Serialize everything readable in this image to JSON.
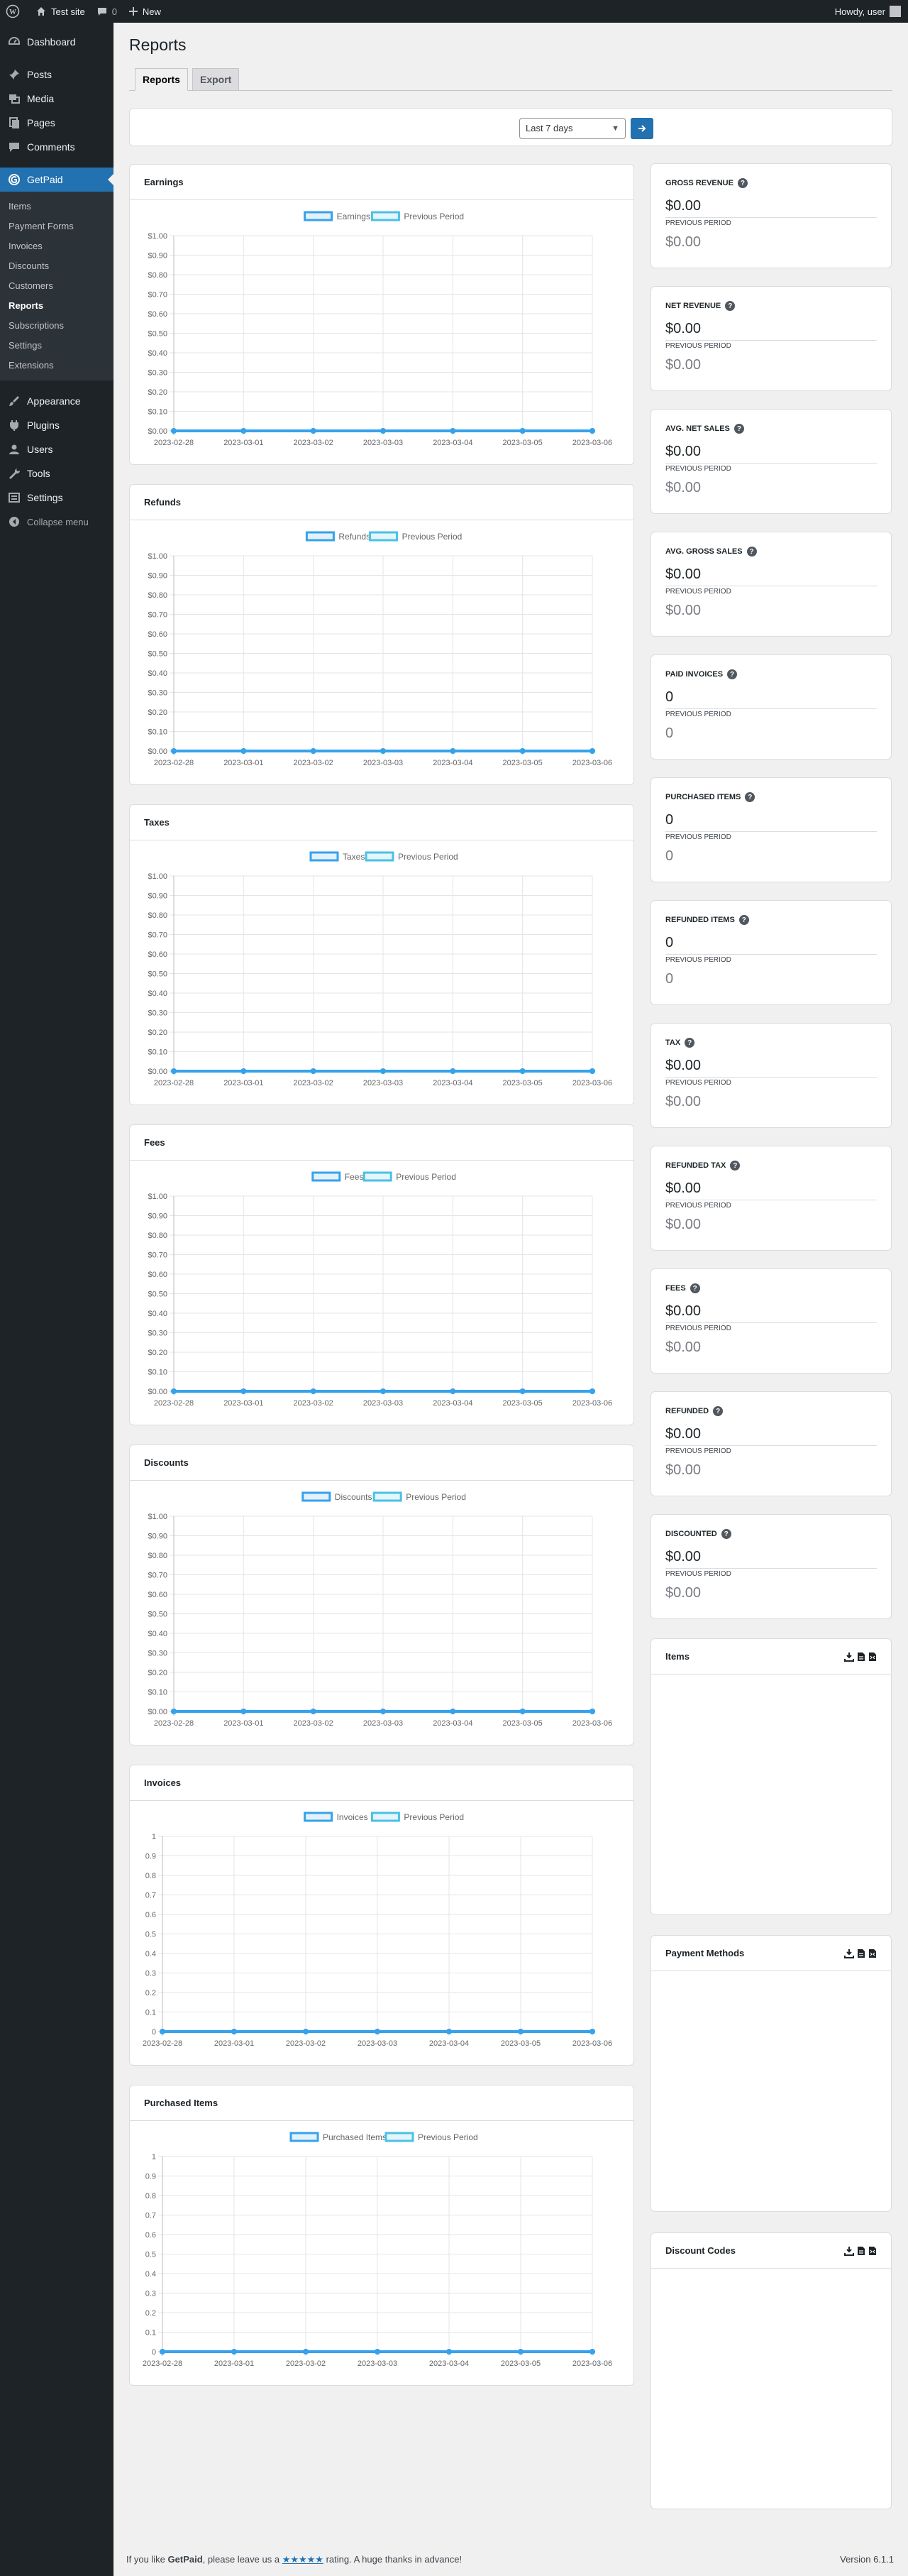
{
  "adminbar": {
    "site_name": "Test site",
    "comments_count": "0",
    "new_label": "New",
    "howdy": "Howdy, user"
  },
  "sidebar": {
    "items_top": [
      {
        "label": "Dashboard",
        "icon": "dashboard-icon"
      }
    ],
    "items_mid": [
      {
        "label": "Posts",
        "icon": "pin-icon"
      },
      {
        "label": "Media",
        "icon": "media-icon"
      },
      {
        "label": "Pages",
        "icon": "pages-icon"
      },
      {
        "label": "Comments",
        "icon": "comment-icon"
      }
    ],
    "getpaid": {
      "label": "GetPaid",
      "icon": "getpaid-icon"
    },
    "submenu": [
      "Items",
      "Payment Forms",
      "Invoices",
      "Discounts",
      "Customers",
      "Reports",
      "Subscriptions",
      "Settings",
      "Extensions"
    ],
    "items_bottom": [
      {
        "label": "Appearance",
        "icon": "brush-icon"
      },
      {
        "label": "Plugins",
        "icon": "plug-icon"
      },
      {
        "label": "Users",
        "icon": "users-icon"
      },
      {
        "label": "Tools",
        "icon": "wrench-icon"
      },
      {
        "label": "Settings",
        "icon": "settings-icon"
      }
    ],
    "collapse": "Collapse menu"
  },
  "page": {
    "title": "Reports",
    "tabs": [
      "Reports",
      "Export"
    ],
    "range_selected": "Last 7 days"
  },
  "charts": [
    {
      "title": "Earnings",
      "legend": [
        "Earnings",
        "Previous Period"
      ]
    },
    {
      "title": "Refunds",
      "legend": [
        "Refunds",
        "Previous Period"
      ]
    },
    {
      "title": "Taxes",
      "legend": [
        "Taxes",
        "Previous Period"
      ]
    },
    {
      "title": "Fees",
      "legend": [
        "Fees",
        "Previous Period"
      ]
    },
    {
      "title": "Discounts",
      "legend": [
        "Discounts",
        "Previous Period"
      ]
    },
    {
      "title": "Invoices",
      "legend": [
        "Invoices",
        "Previous Period"
      ]
    },
    {
      "title": "Purchased Items",
      "legend": [
        "Purchased Items",
        "Previous Period"
      ]
    }
  ],
  "chart_data": [
    {
      "type": "line",
      "title": "Earnings",
      "x": [
        "2023-02-28",
        "2023-03-01",
        "2023-03-02",
        "2023-03-03",
        "2023-03-04",
        "2023-03-05",
        "2023-03-06"
      ],
      "yticks": [
        "$0.00",
        "$0.10",
        "$0.20",
        "$0.30",
        "$0.40",
        "$0.50",
        "$0.60",
        "$0.70",
        "$0.80",
        "$0.90",
        "$1.00"
      ],
      "ylim": [
        0,
        1
      ],
      "series": [
        {
          "name": "Earnings",
          "values": [
            0,
            0,
            0,
            0,
            0,
            0,
            0
          ]
        },
        {
          "name": "Previous Period",
          "values": [
            0,
            0,
            0,
            0,
            0,
            0,
            0
          ]
        }
      ],
      "legend": "top",
      "grid": true
    },
    {
      "type": "line",
      "title": "Refunds",
      "x": [
        "2023-02-28",
        "2023-03-01",
        "2023-03-02",
        "2023-03-03",
        "2023-03-04",
        "2023-03-05",
        "2023-03-06"
      ],
      "yticks": [
        "$0.00",
        "$0.10",
        "$0.20",
        "$0.30",
        "$0.40",
        "$0.50",
        "$0.60",
        "$0.70",
        "$0.80",
        "$0.90",
        "$1.00"
      ],
      "ylim": [
        0,
        1
      ],
      "series": [
        {
          "name": "Refunds",
          "values": [
            0,
            0,
            0,
            0,
            0,
            0,
            0
          ]
        },
        {
          "name": "Previous Period",
          "values": [
            0,
            0,
            0,
            0,
            0,
            0,
            0
          ]
        }
      ],
      "legend": "top",
      "grid": true
    },
    {
      "type": "line",
      "title": "Taxes",
      "x": [
        "2023-02-28",
        "2023-03-01",
        "2023-03-02",
        "2023-03-03",
        "2023-03-04",
        "2023-03-05",
        "2023-03-06"
      ],
      "yticks": [
        "$0.00",
        "$0.10",
        "$0.20",
        "$0.30",
        "$0.40",
        "$0.50",
        "$0.60",
        "$0.70",
        "$0.80",
        "$0.90",
        "$1.00"
      ],
      "ylim": [
        0,
        1
      ],
      "series": [
        {
          "name": "Taxes",
          "values": [
            0,
            0,
            0,
            0,
            0,
            0,
            0
          ]
        },
        {
          "name": "Previous Period",
          "values": [
            0,
            0,
            0,
            0,
            0,
            0,
            0
          ]
        }
      ],
      "legend": "top",
      "grid": true
    },
    {
      "type": "line",
      "title": "Fees",
      "x": [
        "2023-02-28",
        "2023-03-01",
        "2023-03-02",
        "2023-03-03",
        "2023-03-04",
        "2023-03-05",
        "2023-03-06"
      ],
      "yticks": [
        "$0.00",
        "$0.10",
        "$0.20",
        "$0.30",
        "$0.40",
        "$0.50",
        "$0.60",
        "$0.70",
        "$0.80",
        "$0.90",
        "$1.00"
      ],
      "ylim": [
        0,
        1
      ],
      "series": [
        {
          "name": "Fees",
          "values": [
            0,
            0,
            0,
            0,
            0,
            0,
            0
          ]
        },
        {
          "name": "Previous Period",
          "values": [
            0,
            0,
            0,
            0,
            0,
            0,
            0
          ]
        }
      ],
      "legend": "top",
      "grid": true
    },
    {
      "type": "line",
      "title": "Discounts",
      "x": [
        "2023-02-28",
        "2023-03-01",
        "2023-03-02",
        "2023-03-03",
        "2023-03-04",
        "2023-03-05",
        "2023-03-06"
      ],
      "yticks": [
        "$0.00",
        "$0.10",
        "$0.20",
        "$0.30",
        "$0.40",
        "$0.50",
        "$0.60",
        "$0.70",
        "$0.80",
        "$0.90",
        "$1.00"
      ],
      "ylim": [
        0,
        1
      ],
      "series": [
        {
          "name": "Discounts",
          "values": [
            0,
            0,
            0,
            0,
            0,
            0,
            0
          ]
        },
        {
          "name": "Previous Period",
          "values": [
            0,
            0,
            0,
            0,
            0,
            0,
            0
          ]
        }
      ],
      "legend": "top",
      "grid": true
    },
    {
      "type": "line",
      "title": "Invoices",
      "x": [
        "2023-02-28",
        "2023-03-01",
        "2023-03-02",
        "2023-03-03",
        "2023-03-04",
        "2023-03-05",
        "2023-03-06"
      ],
      "yticks": [
        "0",
        "0.1",
        "0.2",
        "0.3",
        "0.4",
        "0.5",
        "0.6",
        "0.7",
        "0.8",
        "0.9",
        "1"
      ],
      "ylim": [
        0,
        1
      ],
      "series": [
        {
          "name": "Invoices",
          "values": [
            0,
            0,
            0,
            0,
            0,
            0,
            0
          ]
        },
        {
          "name": "Previous Period",
          "values": [
            0,
            0,
            0,
            0,
            0,
            0,
            0
          ]
        }
      ],
      "legend": "top",
      "grid": true
    },
    {
      "type": "line",
      "title": "Purchased Items",
      "x": [
        "2023-02-28",
        "2023-03-01",
        "2023-03-02",
        "2023-03-03",
        "2023-03-04",
        "2023-03-05",
        "2023-03-06"
      ],
      "yticks": [
        "0",
        "0.1",
        "0.2",
        "0.3",
        "0.4",
        "0.5",
        "0.6",
        "0.7",
        "0.8",
        "0.9",
        "1"
      ],
      "ylim": [
        0,
        1
      ],
      "series": [
        {
          "name": "Purchased Items",
          "values": [
            0,
            0,
            0,
            0,
            0,
            0,
            0
          ]
        },
        {
          "name": "Previous Period",
          "values": [
            0,
            0,
            0,
            0,
            0,
            0,
            0
          ]
        }
      ],
      "legend": "top",
      "grid": true
    }
  ],
  "stats": [
    {
      "title": "Gross Revenue",
      "value": "$0.00",
      "prev_label": "Previous Period",
      "prev_value": "$0.00"
    },
    {
      "title": "Net Revenue",
      "value": "$0.00",
      "prev_label": "Previous Period",
      "prev_value": "$0.00"
    },
    {
      "title": "Avg. Net Sales",
      "value": "$0.00",
      "prev_label": "Previous Period",
      "prev_value": "$0.00"
    },
    {
      "title": "Avg. Gross Sales",
      "value": "$0.00",
      "prev_label": "Previous Period",
      "prev_value": "$0.00"
    },
    {
      "title": "Paid Invoices",
      "value": "0",
      "prev_label": "Previous Period",
      "prev_value": "0"
    },
    {
      "title": "Purchased Items",
      "value": "0",
      "prev_label": "Previous Period",
      "prev_value": "0"
    },
    {
      "title": "Refunded Items",
      "value": "0",
      "prev_label": "Previous Period",
      "prev_value": "0"
    },
    {
      "title": "Tax",
      "value": "$0.00",
      "prev_label": "Previous Period",
      "prev_value": "$0.00"
    },
    {
      "title": "Refunded Tax",
      "value": "$0.00",
      "prev_label": "Previous Period",
      "prev_value": "$0.00"
    },
    {
      "title": "Fees",
      "value": "$0.00",
      "prev_label": "Previous Period",
      "prev_value": "$0.00"
    },
    {
      "title": "Refunded",
      "value": "$0.00",
      "prev_label": "Previous Period",
      "prev_value": "$0.00"
    },
    {
      "title": "Discounted",
      "value": "$0.00",
      "prev_label": "Previous Period",
      "prev_value": "$0.00"
    }
  ],
  "side_cards": [
    {
      "title": "Items"
    },
    {
      "title": "Payment Methods"
    },
    {
      "title": "Discount Codes"
    }
  ],
  "footer": {
    "pre": "If you like ",
    "brand": "GetPaid",
    "mid": ", please leave us a ",
    "stars": "★★★★★",
    "post": " rating. A huge thanks in advance!",
    "version": "Version 6.1.1"
  },
  "colors": {
    "accent": "#2271b1",
    "series_current": "#36a2eb",
    "series_previous": "#4bc0e6",
    "sidebar_bg": "#1d2327"
  }
}
